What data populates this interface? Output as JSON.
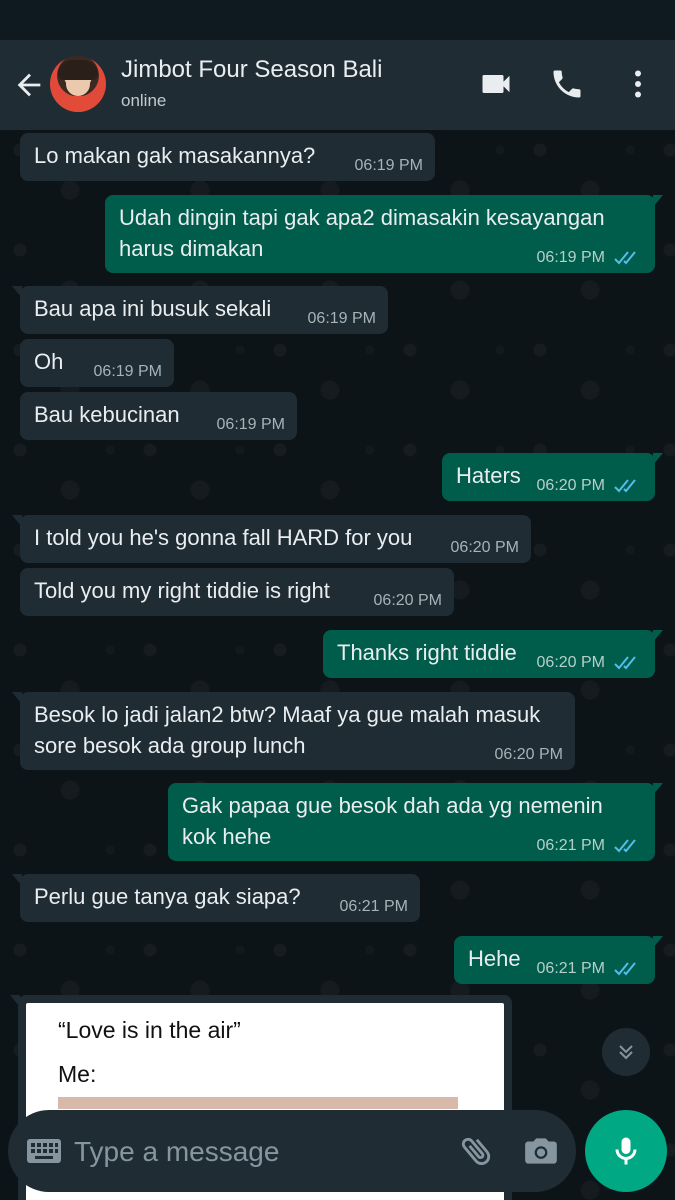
{
  "header": {
    "contact_name": "Jimbot Four Season Bali",
    "status": "online"
  },
  "messages": [
    {
      "dir": "in",
      "text": "Lo makan gak masakannya?",
      "time": "06:19 PM"
    },
    {
      "dir": "out",
      "text": "Udah dingin tapi gak apa2 dimasakin kesayangan\nharus dimakan",
      "time": "06:19 PM"
    },
    {
      "dir": "in",
      "text": "Bau apa ini busuk sekali",
      "time": "06:19 PM"
    },
    {
      "dir": "in",
      "text": "Oh",
      "time": "06:19 PM"
    },
    {
      "dir": "in",
      "text": "Bau kebucinan",
      "time": "06:19 PM"
    },
    {
      "dir": "out",
      "text": "Haters",
      "time": "06:20 PM"
    },
    {
      "dir": "in",
      "text": "I told you he's gonna fall HARD for you",
      "time": "06:20 PM"
    },
    {
      "dir": "in",
      "text": "Told you my right tiddie is right",
      "time": "06:20 PM"
    },
    {
      "dir": "out",
      "text": "Thanks right tiddie",
      "time": "06:20 PM"
    },
    {
      "dir": "in",
      "text": "Besok lo jadi jalan2 btw? Maaf ya gue malah masuk\nsore besok ada group lunch",
      "time": "06:20 PM"
    },
    {
      "dir": "out",
      "text": "Gak papaa gue besok dah ada yg nemenin\nkok hehe",
      "time": "06:21 PM"
    },
    {
      "dir": "in",
      "text": "Perlu gue tanya gak siapa?",
      "time": "06:21 PM"
    },
    {
      "dir": "out",
      "text": "Hehe",
      "time": "06:21 PM"
    }
  ],
  "image_message": {
    "line1": "“Love is in the air”",
    "line2": "Me:"
  },
  "composer": {
    "placeholder": "Type a message"
  },
  "icons": {
    "back": "arrow-back-icon",
    "video": "video-call-icon",
    "call": "phone-icon",
    "menu": "more-vert-icon",
    "keyboard": "keyboard-icon",
    "attach": "paperclip-icon",
    "camera": "camera-icon",
    "mic": "mic-icon",
    "read": "double-check-icon",
    "scroll": "chevron-double-down-icon"
  },
  "colors": {
    "header": "#1f2c34",
    "chat_bg": "#0d1418",
    "incoming": "#1f2c34",
    "outgoing": "#005c4b",
    "accent": "#00a884",
    "read_ticks": "#53bdeb"
  }
}
